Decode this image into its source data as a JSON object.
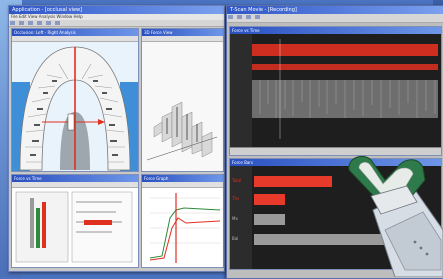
{
  "left_window": {
    "title": "Application - [occlusal view]",
    "menu": "File  Edit  View  Analysis  Window  Help"
  },
  "panes": {
    "arch": {
      "title": "Occlusion: Left - Right Analysis"
    },
    "view3d": {
      "title": "3D Force View"
    },
    "bottom_left": {
      "title": "Force vs Time"
    },
    "bottom_right": {
      "title": "Force Graph"
    }
  },
  "right_window": {
    "title": "T-Scan Movie - [Recording]",
    "top_pane_title": "Force vs Time",
    "bottom_pane_title": "Force Bars",
    "bar_labels": [
      "Total",
      "Ths",
      "Mx",
      "Bal"
    ]
  },
  "colors": {
    "accent_red": "#e03020",
    "title_blue": "#2a50c0",
    "plot_dark": "#1e1e1e",
    "gray_bar": "#9a9a9a"
  },
  "bars": {
    "values_fraction": [
      0.42,
      0.17,
      0.17,
      0.9
    ],
    "colors": [
      "#e83a2a",
      "#e83a2a",
      "#9a9a9a",
      "#9a9a9a"
    ]
  }
}
